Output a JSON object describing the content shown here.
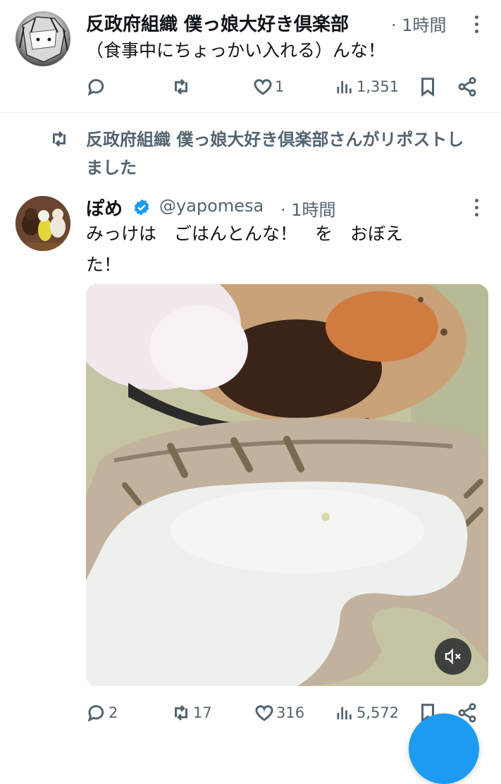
{
  "tweet1": {
    "author": "反政府組織 僕っ娘大好き倶楽部",
    "time": "· 1時間",
    "text": "（食事中にちょっかい入れる）んな！",
    "likes": "1",
    "views": "1,351"
  },
  "repost_banner": {
    "line1": "反政府組織 僕っ娘大好き倶楽部さんがリポストし",
    "line2": "ました"
  },
  "tweet2": {
    "author": "ぽめ",
    "handle": "@yapomesa",
    "time": "· 1時間",
    "text_line1": "みっけは　ごはんとんな！　を　おぼえ",
    "text_line2": "た！",
    "replies": "2",
    "reposts": "17",
    "likes": "316",
    "views": "5,572"
  },
  "colors": {
    "text": "#0f1419",
    "muted": "#536471",
    "verified": "#1d9bf0",
    "fab": "#1d9bf0"
  },
  "icons": [
    "reply-icon",
    "repost-icon",
    "like-icon",
    "views-icon",
    "bookmark-icon",
    "share-icon",
    "more-icon",
    "verified-badge-icon",
    "mute-icon"
  ]
}
